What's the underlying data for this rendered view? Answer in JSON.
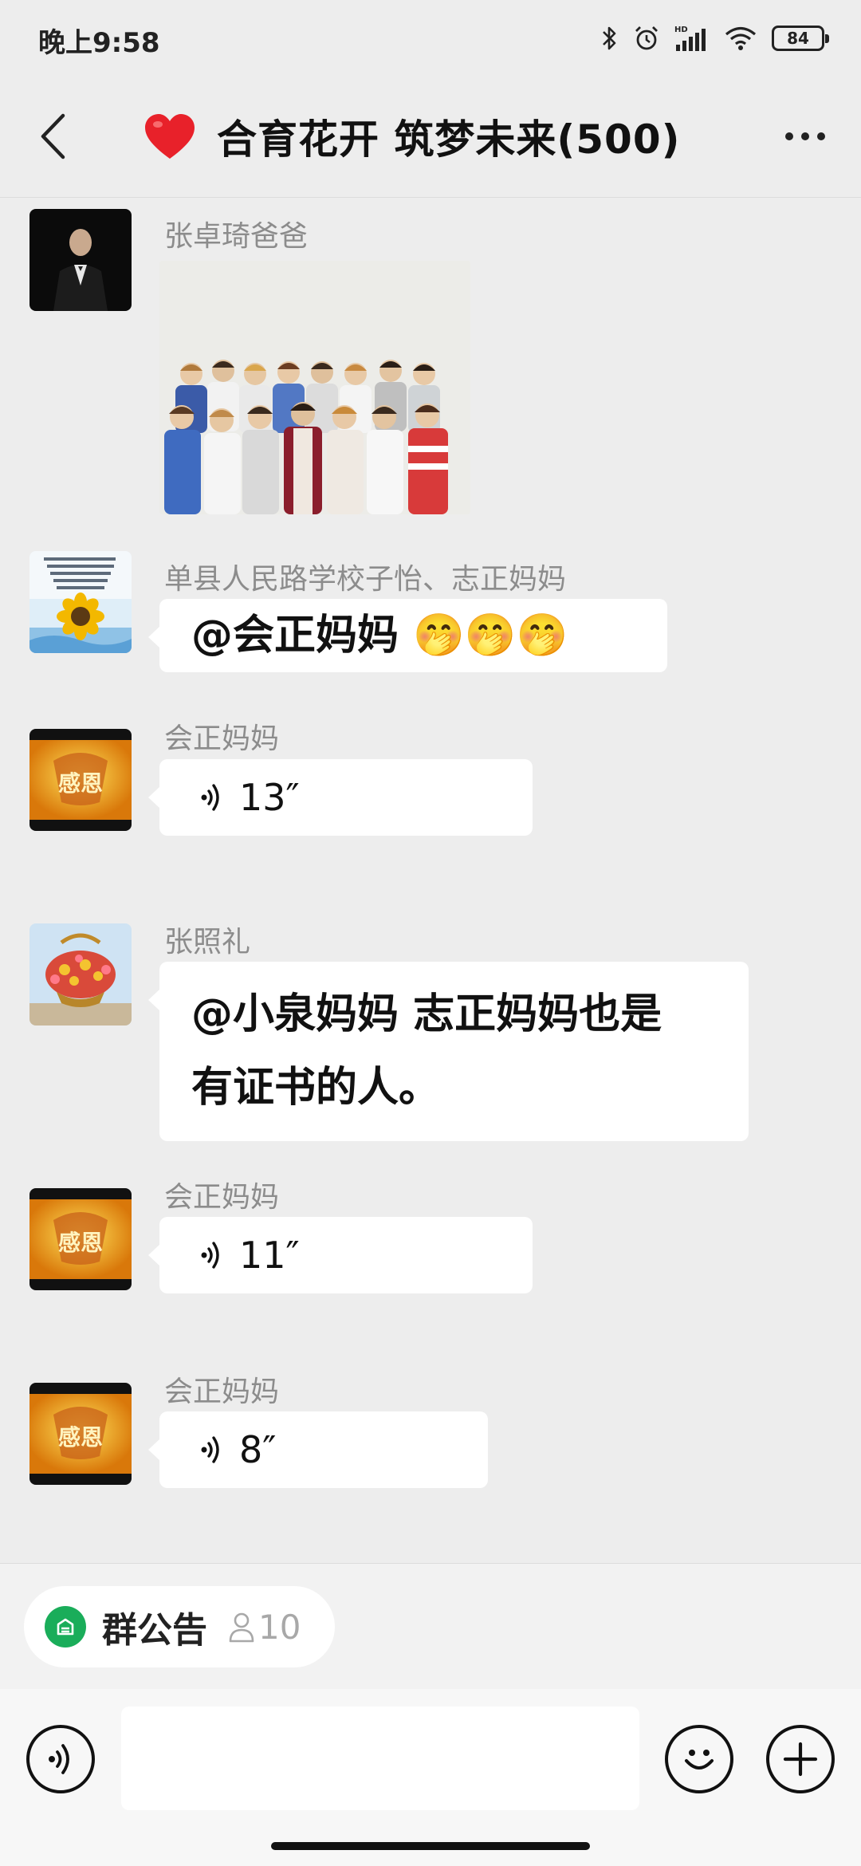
{
  "status_bar": {
    "time": "晚上9:58",
    "battery": "84",
    "icons": [
      "bluetooth-icon",
      "alarm-icon",
      "hd-signal-icon",
      "wifi-icon",
      "battery-icon"
    ]
  },
  "header": {
    "title": "合育花开 筑梦未来(500)",
    "back_icon": "chevron-left-icon",
    "more_icon": "more-dots-icon",
    "heart_color": "#e8212a"
  },
  "messages": [
    {
      "sender": "张卓琦爸爸",
      "type": "image"
    },
    {
      "sender": "单县人民路学校子怡、志正妈妈",
      "type": "text",
      "text": "@会正妈妈 🤭🤭🤭"
    },
    {
      "sender": "会正妈妈",
      "type": "voice",
      "duration": "13″"
    },
    {
      "sender": "张照礼",
      "type": "text",
      "lines": [
        "@小泉妈妈  志正妈妈也是",
        "有证书的人。"
      ]
    },
    {
      "sender": "会正妈妈",
      "type": "voice",
      "duration": "11″"
    },
    {
      "sender": "会正妈妈",
      "type": "voice",
      "duration": "8″"
    }
  ],
  "bottom": {
    "notice_label": "群公告",
    "notice_count": "10",
    "input_placeholder": "",
    "icons": [
      "voice-icon",
      "emoji-icon",
      "plus-icon"
    ]
  },
  "colors": {
    "background": "#ededed",
    "bubble": "#ffffff",
    "sender_name": "#8c8c8c",
    "notice_green": "#1aad5a"
  }
}
